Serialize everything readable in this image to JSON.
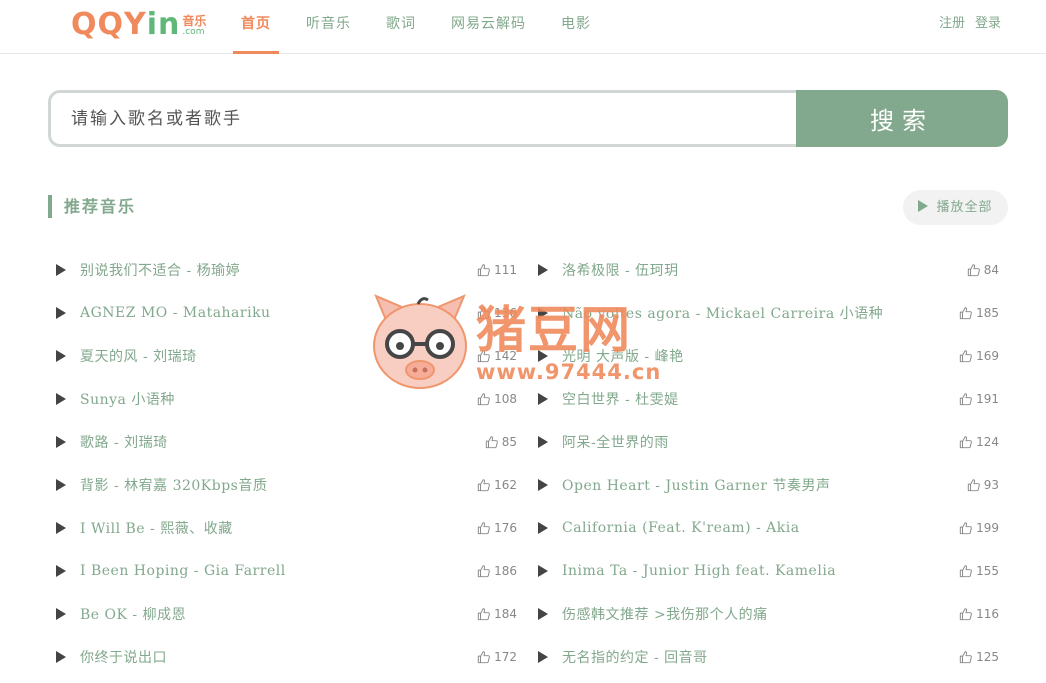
{
  "header": {
    "logo_text_a": "QQY",
    "logo_text_b": "in",
    "logo_side_a": "音乐",
    "logo_side_b": ".com",
    "nav": [
      {
        "label": "首页",
        "active": true
      },
      {
        "label": "听音乐",
        "active": false
      },
      {
        "label": "歌词",
        "active": false
      },
      {
        "label": "网易云解码",
        "active": false
      },
      {
        "label": "电影",
        "active": false
      }
    ],
    "register": "注册",
    "login": "登录"
  },
  "search": {
    "placeholder": "请输入歌名或者歌手",
    "button": "搜索"
  },
  "section": {
    "title": "推荐音乐",
    "play_all": "播放全部"
  },
  "songs_left": [
    {
      "title": "别说我们不适合 - 杨瑜婷",
      "likes": "111"
    },
    {
      "title": "AGNEZ MO - Matahariku",
      "likes": "136"
    },
    {
      "title": "夏天的风 - 刘瑞琦",
      "likes": "142"
    },
    {
      "title": "Sunya 小语种",
      "likes": "108"
    },
    {
      "title": "歌路 - 刘瑞琦",
      "likes": "85"
    },
    {
      "title": "背影 - 林宥嘉 320Kbps音质",
      "likes": "162"
    },
    {
      "title": "I Will Be - 熙薇、收藏",
      "likes": "176"
    },
    {
      "title": "I Been Hoping - Gia Farrell",
      "likes": "186"
    },
    {
      "title": "Be OK - 柳成恩",
      "likes": "184"
    },
    {
      "title": "你终于说出口",
      "likes": "172"
    }
  ],
  "songs_right": [
    {
      "title": "洛希极限 - 伍珂玥",
      "likes": "84"
    },
    {
      "title": "Não voltes agora - Mickael Carreira 小语种",
      "likes": "185"
    },
    {
      "title": "光明 大声版 - 峰艳",
      "likes": "169"
    },
    {
      "title": "空白世界 - 杜雯媞",
      "likes": "191"
    },
    {
      "title": "阿呆-全世界的雨",
      "likes": "124"
    },
    {
      "title": "Open Heart - Justin Garner 节奏男声",
      "likes": "93"
    },
    {
      "title": "California (Feat. K'ream) - Akia",
      "likes": "199"
    },
    {
      "title": "Inima Ta - Junior High feat. Kamelia",
      "likes": "155"
    },
    {
      "title": "伤感韩文推荐 >我伤那个人的痛",
      "likes": "116"
    },
    {
      "title": "无名指的约定 - 回音哥",
      "likes": "125"
    }
  ],
  "watermark": {
    "name": "猪豆网",
    "url": "www.97444.cn"
  }
}
